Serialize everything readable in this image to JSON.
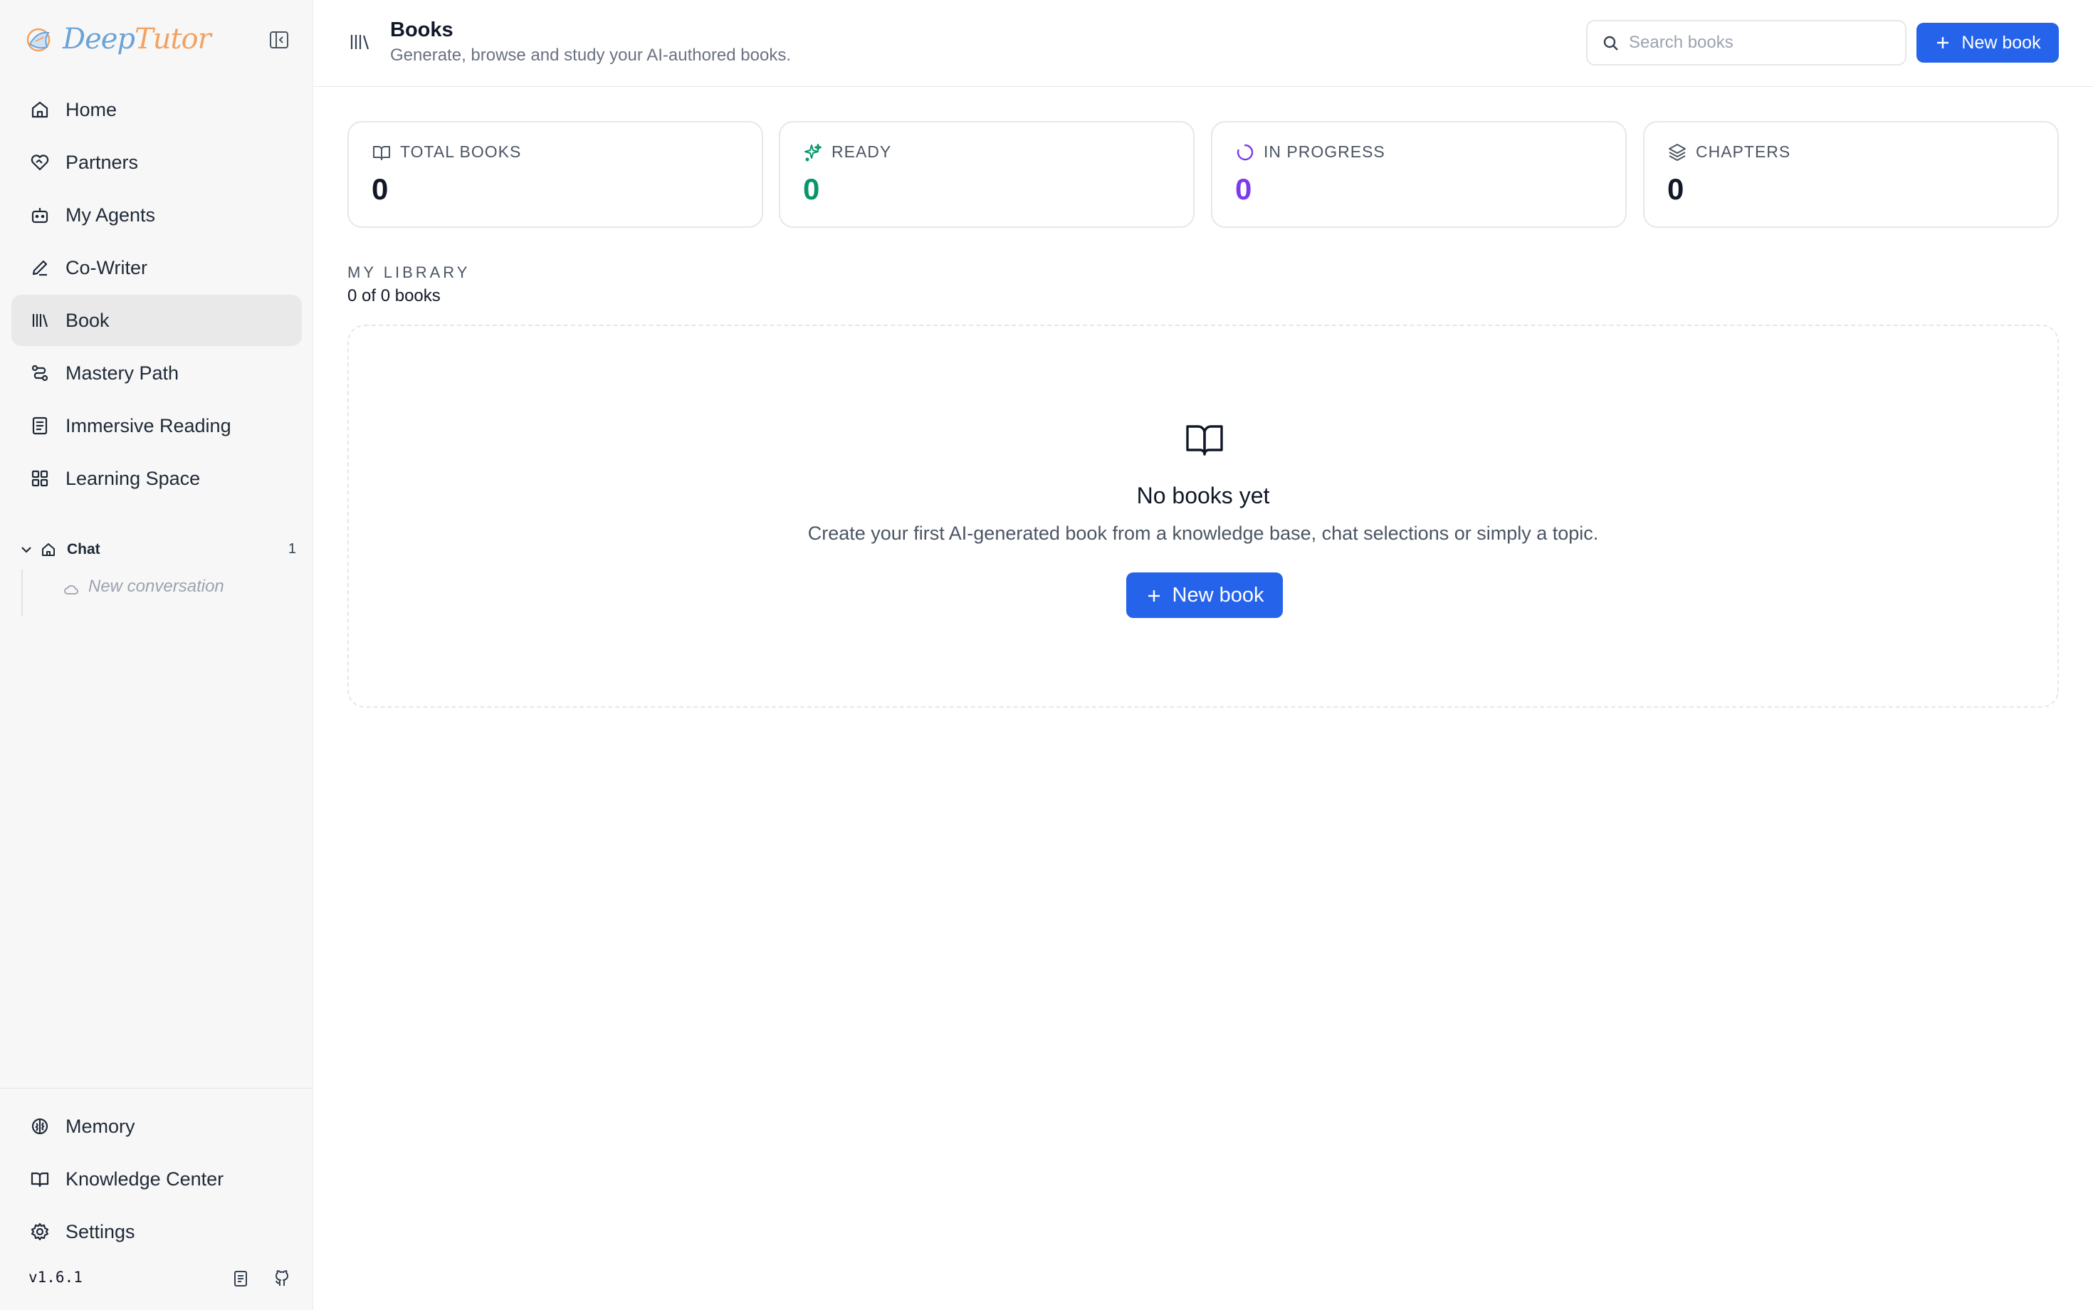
{
  "app": {
    "logo_left": "Deep",
    "logo_right": "Tutor",
    "accent_color": "#2563eb"
  },
  "sidebar": {
    "items": [
      {
        "label": "Home",
        "icon": "home-icon"
      },
      {
        "label": "Partners",
        "icon": "heart-handshake-icon"
      },
      {
        "label": "My Agents",
        "icon": "bot-icon"
      },
      {
        "label": "Co-Writer",
        "icon": "pen-icon"
      },
      {
        "label": "Book",
        "icon": "library-icon",
        "active": true
      },
      {
        "label": "Mastery Path",
        "icon": "route-icon"
      },
      {
        "label": "Immersive Reading",
        "icon": "document-icon"
      },
      {
        "label": "Learning Space",
        "icon": "grid-icon"
      }
    ],
    "chat": {
      "label": "Chat",
      "count": "1",
      "conversation": "New conversation"
    },
    "bottom_items": [
      {
        "label": "Memory",
        "icon": "brain-icon"
      },
      {
        "label": "Knowledge Center",
        "icon": "book-open-icon"
      },
      {
        "label": "Settings",
        "icon": "gear-icon"
      }
    ],
    "version": "v1.6.1"
  },
  "header": {
    "title": "Books",
    "subtitle": "Generate, browse and study your AI-authored books.",
    "search_placeholder": "Search books",
    "new_book_label": "New book"
  },
  "stats": [
    {
      "label": "TOTAL BOOKS",
      "value": "0",
      "color": "#111827",
      "icon": "book-open-icon"
    },
    {
      "label": "READY",
      "value": "0",
      "color": "#059669",
      "icon": "sparkles-icon"
    },
    {
      "label": "IN PROGRESS",
      "value": "0",
      "color": "#7c3aed",
      "icon": "loader-icon"
    },
    {
      "label": "CHAPTERS",
      "value": "0",
      "color": "#111827",
      "icon": "layers-icon"
    }
  ],
  "library": {
    "title": "MY LIBRARY",
    "count": "0 of 0 books",
    "empty_title": "No books yet",
    "empty_desc": "Create your first AI-generated book from a knowledge base, chat selections or simply a topic.",
    "new_book_label": "New book"
  }
}
